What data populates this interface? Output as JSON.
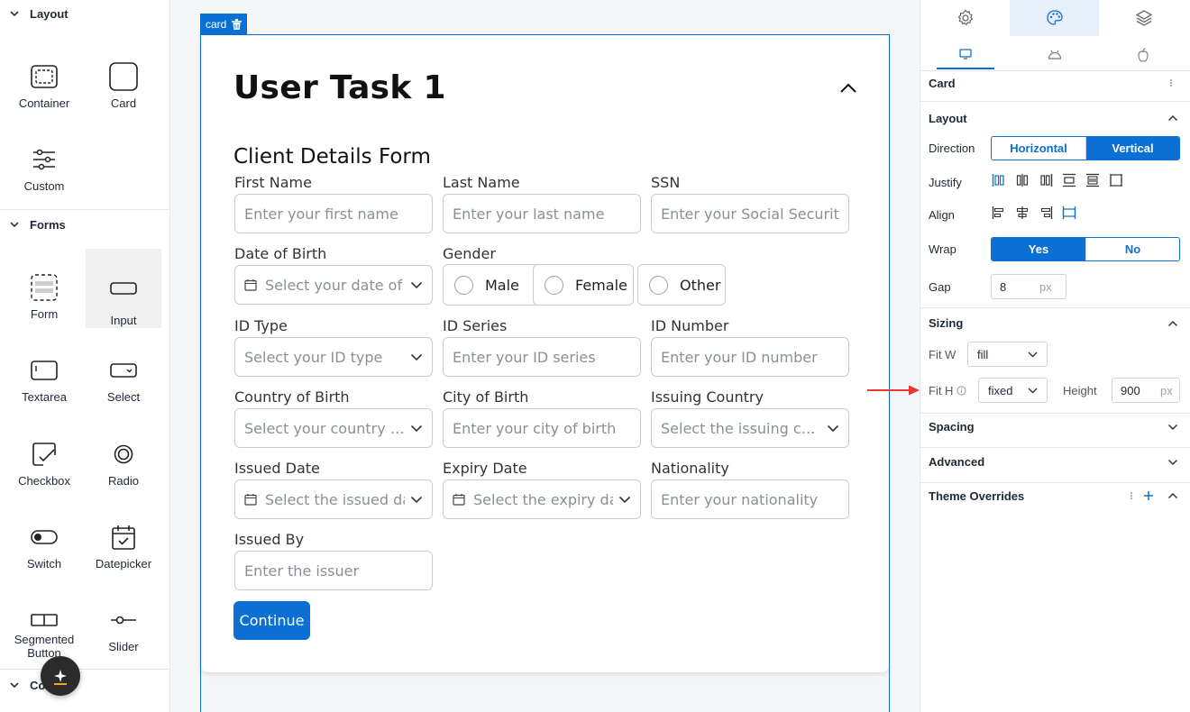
{
  "left_sidebar": {
    "sections": [
      {
        "title": "Layout"
      },
      {
        "title": "Forms"
      },
      {
        "title": "Co…ion"
      }
    ],
    "layout_items": [
      {
        "label": "Container",
        "icon": "container-icon"
      },
      {
        "label": "Card",
        "icon": "card-icon"
      },
      {
        "label": "Custom",
        "icon": "custom-icon"
      }
    ],
    "form_items": [
      {
        "label": "Form",
        "icon": "form-icon"
      },
      {
        "label": "Input",
        "icon": "input-icon",
        "selected": true
      },
      {
        "label": "Textarea",
        "icon": "textarea-icon"
      },
      {
        "label": "Select",
        "icon": "select-icon"
      },
      {
        "label": "Checkbox",
        "icon": "checkbox-icon"
      },
      {
        "label": "Radio",
        "icon": "radio-icon"
      },
      {
        "label": "Switch",
        "icon": "switch-icon"
      },
      {
        "label": "Datepicker",
        "icon": "datepicker-icon"
      },
      {
        "label": "Segmented Button",
        "icon": "segmented-button-icon"
      },
      {
        "label": "Slider",
        "icon": "slider-icon"
      }
    ]
  },
  "canvas": {
    "tag_label": "card",
    "card_title": "User Task 1",
    "form_title": "Client Details Form",
    "fields": {
      "first_name": {
        "label": "First Name",
        "placeholder": "Enter your first name"
      },
      "last_name": {
        "label": "Last Name",
        "placeholder": "Enter your last name"
      },
      "ssn": {
        "label": "SSN",
        "placeholder": "Enter your Social Security Nu"
      },
      "dob": {
        "label": "Date of Birth",
        "placeholder": "Select your date of bir"
      },
      "gender": {
        "label": "Gender",
        "options": [
          "Male",
          "Female",
          "Other"
        ]
      },
      "id_type": {
        "label": "ID Type",
        "placeholder": "Select your ID type"
      },
      "id_series": {
        "label": "ID Series",
        "placeholder": "Enter your ID series"
      },
      "id_number": {
        "label": "ID Number",
        "placeholder": "Enter your ID number"
      },
      "country_of_birth": {
        "label": "Country of Birth",
        "placeholder": "Select your country of ..."
      },
      "city_of_birth": {
        "label": "City of Birth",
        "placeholder": "Enter your city of birth"
      },
      "issuing_country": {
        "label": "Issuing Country",
        "placeholder": "Select the issuing coun..."
      },
      "issued_date": {
        "label": "Issued Date",
        "placeholder": "Select the issued date"
      },
      "expiry_date": {
        "label": "Expiry Date",
        "placeholder": "Select the expiry date"
      },
      "nationality": {
        "label": "Nationality",
        "placeholder": "Enter your nationality"
      },
      "issued_by": {
        "label": "Issued By",
        "placeholder": "Enter the issuer"
      }
    },
    "continue_label": "Continue"
  },
  "right_panel": {
    "top_tabs": [
      "settings-icon",
      "palette-icon",
      "layers-icon"
    ],
    "device_tabs": [
      "desktop-icon",
      "android-icon",
      "apple-icon"
    ],
    "component_name": "Card",
    "layout": {
      "title": "Layout",
      "direction_label": "Direction",
      "direction_options": [
        "Horizontal",
        "Vertical"
      ],
      "direction_selected": "Vertical",
      "justify_label": "Justify",
      "align_label": "Align",
      "wrap_label": "Wrap",
      "wrap_options": [
        "Yes",
        "No"
      ],
      "wrap_selected": "Yes",
      "gap_label": "Gap",
      "gap_value": "8",
      "gap_unit": "px"
    },
    "sizing": {
      "title": "Sizing",
      "fit_w_label": "Fit W",
      "fit_w_value": "fill",
      "fit_h_label": "Fit H",
      "fit_h_value": "fixed",
      "height_label": "Height",
      "height_value": "900",
      "height_unit": "px"
    },
    "collapsed_sections": [
      "Spacing",
      "Advanced"
    ],
    "theme_overrides": "Theme Overrides"
  },
  "colors": {
    "accent": "#0b6fd3",
    "annotation_arrow": "#e53935"
  }
}
